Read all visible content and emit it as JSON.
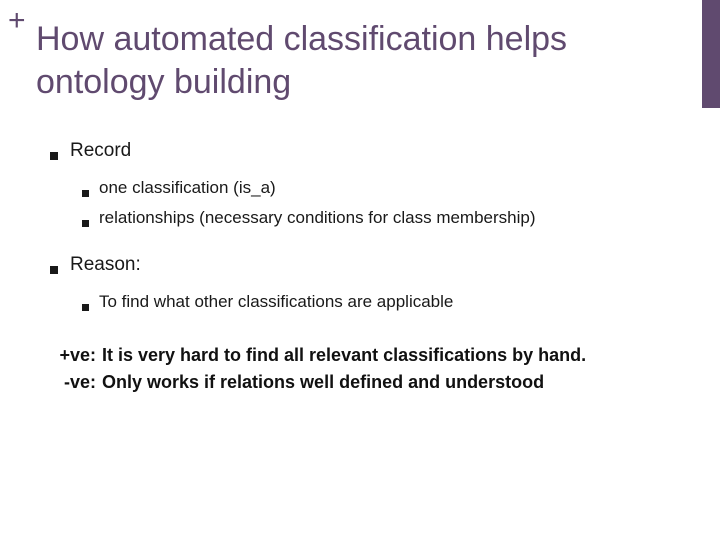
{
  "colors": {
    "accent": "#604a6f"
  },
  "plus": "+",
  "title": "How automated classification helps ontology building",
  "bullets": {
    "record": {
      "label": "Record",
      "items": {
        "a": "one classification (is_a)",
        "b": "relationships (necessary conditions for class membership)"
      }
    },
    "reason": {
      "label": "Reason:",
      "items": {
        "a": "To find what other classifications are applicable"
      }
    }
  },
  "notes": {
    "pos": {
      "label": "+ve:",
      "text": "It is very hard to find all relevant classifications by hand."
    },
    "neg": {
      "label": "-ve:",
      "text": "Only works if relations well defined and understood"
    }
  }
}
